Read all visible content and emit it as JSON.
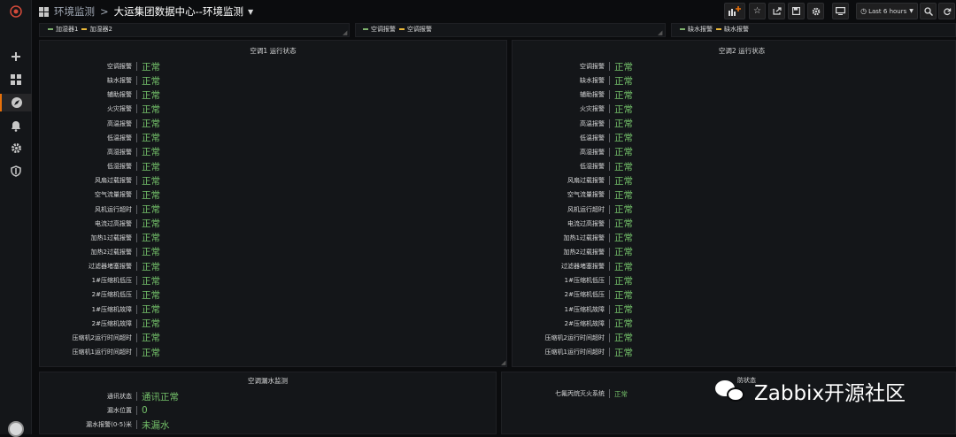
{
  "sidebar": {
    "icons": [
      "plus-icon",
      "dashboards-icon",
      "explore-icon",
      "alert-bell-icon",
      "gear-icon",
      "shield-icon"
    ]
  },
  "header": {
    "folder": "环境监测",
    "separator": ">",
    "title": "大运集团数据中心--环境监测",
    "time_range": "Last 6 hours"
  },
  "legends": {
    "humidifier": [
      {
        "name": "加湿器1",
        "color": "#7eb26d"
      },
      {
        "name": "加湿器2",
        "color": "#eab839"
      }
    ],
    "ac_alarm": [
      {
        "name": "空调报警",
        "color": "#7eb26d"
      },
      {
        "name": "空调报警",
        "color": "#eab839"
      }
    ],
    "water_alarm": [
      {
        "name": "缺水报警",
        "color": "#7eb26d"
      },
      {
        "name": "缺水报警",
        "color": "#eab839"
      }
    ]
  },
  "panel_ac1": {
    "title": "空调1 运行状态",
    "rows": [
      {
        "label": "空调报警",
        "value": "正常"
      },
      {
        "label": "缺水报警",
        "value": "正常"
      },
      {
        "label": "辅助报警",
        "value": "正常"
      },
      {
        "label": "火灾报警",
        "value": "正常"
      },
      {
        "label": "高温报警",
        "value": "正常"
      },
      {
        "label": "低温报警",
        "value": "正常"
      },
      {
        "label": "高湿报警",
        "value": "正常"
      },
      {
        "label": "低湿报警",
        "value": "正常"
      },
      {
        "label": "风扇过载报警",
        "value": "正常"
      },
      {
        "label": "空气流量报警",
        "value": "正常"
      },
      {
        "label": "风机运行超时",
        "value": "正常"
      },
      {
        "label": "电流过高报警",
        "value": "正常"
      },
      {
        "label": "加热1过载报警",
        "value": "正常"
      },
      {
        "label": "加热2过载报警",
        "value": "正常"
      },
      {
        "label": "过滤器堵塞报警",
        "value": "正常"
      },
      {
        "label": "1#压缩机低压",
        "value": "正常"
      },
      {
        "label": "2#压缩机低压",
        "value": "正常"
      },
      {
        "label": "1#压缩机故障",
        "value": "正常"
      },
      {
        "label": "2#压缩机故障",
        "value": "正常"
      },
      {
        "label": "压缩机2运行时间超时",
        "value": "正常"
      },
      {
        "label": "压缩机1运行时间超时",
        "value": "正常"
      }
    ]
  },
  "panel_ac2": {
    "title": "空调2 运行状态",
    "rows": [
      {
        "label": "空调报警",
        "value": "正常"
      },
      {
        "label": "缺水报警",
        "value": "正常"
      },
      {
        "label": "辅助报警",
        "value": "正常"
      },
      {
        "label": "火灾报警",
        "value": "正常"
      },
      {
        "label": "高温报警",
        "value": "正常"
      },
      {
        "label": "低温报警",
        "value": "正常"
      },
      {
        "label": "高湿报警",
        "value": "正常"
      },
      {
        "label": "低湿报警",
        "value": "正常"
      },
      {
        "label": "风扇过载报警",
        "value": "正常"
      },
      {
        "label": "空气流量报警",
        "value": "正常"
      },
      {
        "label": "风机运行超时",
        "value": "正常"
      },
      {
        "label": "电流过高报警",
        "value": "正常"
      },
      {
        "label": "加热1过载报警",
        "value": "正常"
      },
      {
        "label": "加热2过载报警",
        "value": "正常"
      },
      {
        "label": "过滤器堵塞报警",
        "value": "正常"
      },
      {
        "label": "1#压缩机低压",
        "value": "正常"
      },
      {
        "label": "2#压缩机低压",
        "value": "正常"
      },
      {
        "label": "1#压缩机故障",
        "value": "正常"
      },
      {
        "label": "2#压缩机故障",
        "value": "正常"
      },
      {
        "label": "压缩机2运行时间超时",
        "value": "正常"
      },
      {
        "label": "压缩机1运行时间超时",
        "value": "正常"
      }
    ]
  },
  "panel_leak": {
    "title": "空调漏水监测",
    "rows": [
      {
        "label": "通讯状态",
        "value": "通讯正常"
      },
      {
        "label": "漏水位置",
        "value": "0"
      },
      {
        "label": "漏水报警(0-5)米",
        "value": "未漏水"
      }
    ]
  },
  "panel_fire": {
    "title": "防状态",
    "rows": [
      {
        "label": "七氟丙烷灭火系统",
        "value": "正常"
      }
    ]
  },
  "watermark": "Zabbix开源社区",
  "colors": {
    "ok": "#73bf69",
    "accent": "#e8710a"
  }
}
